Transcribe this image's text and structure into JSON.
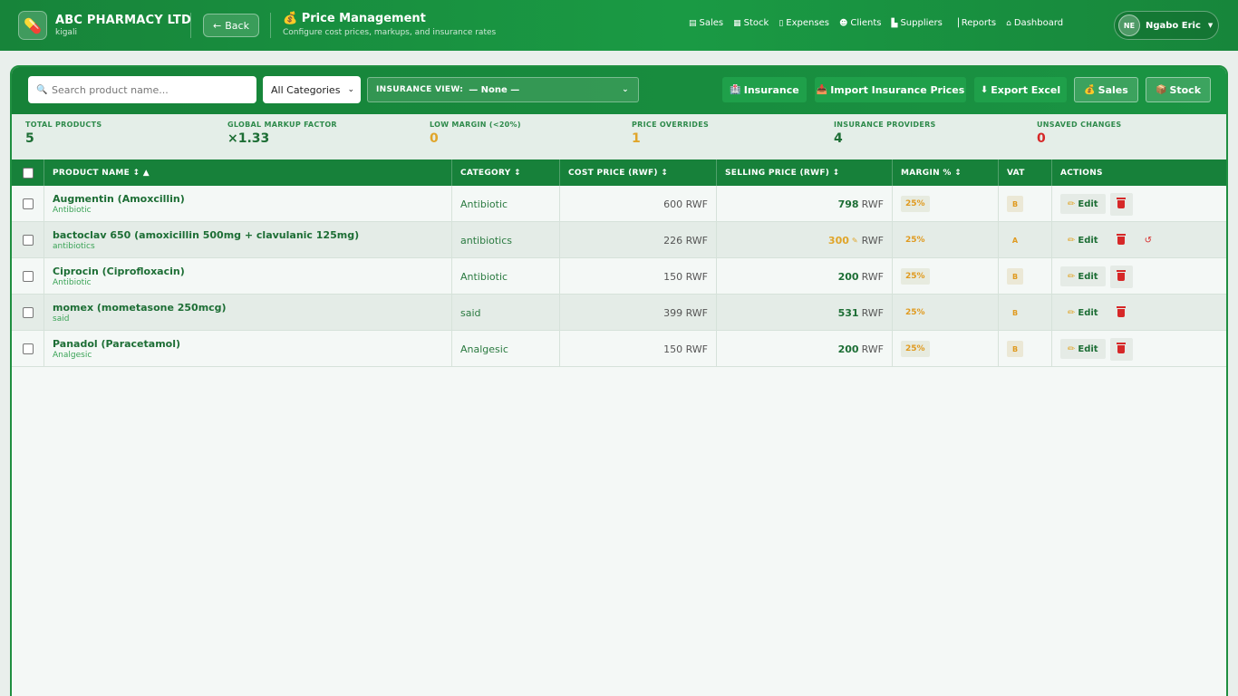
{
  "header": {
    "brand": "ABC PHARMACY LTD",
    "location": "kigali",
    "back_label": "Back",
    "title": "Price Management",
    "subtitle": "Configure cost prices, markups, and insurance rates",
    "nav": [
      {
        "label": "Sales",
        "icon": "receipt-icon"
      },
      {
        "label": "Stock",
        "icon": "boxes-icon"
      },
      {
        "label": "Expenses",
        "icon": "file-icon"
      },
      {
        "label": "Clients",
        "icon": "users-icon"
      },
      {
        "label": "Suppliers",
        "icon": "industry-icon"
      },
      {
        "label": "Reports",
        "icon": "chart-icon"
      },
      {
        "label": "Dashboard",
        "icon": "home-icon"
      }
    ],
    "user": {
      "initials": "NE",
      "name": "Ngabo Eric"
    }
  },
  "toolbar": {
    "search_placeholder": "Search product name...",
    "category_value": "All Categories",
    "insurance_view_label": "INSURANCE VIEW:",
    "insurance_view_value": "— None —",
    "buttons": {
      "insurance": "Insurance",
      "import": "Import Insurance Prices",
      "export": "Export Excel",
      "sales": "Sales",
      "stock": "Stock"
    }
  },
  "stats": [
    {
      "label": "TOTAL PRODUCTS",
      "value": "5",
      "color": "#1d6e35"
    },
    {
      "label": "GLOBAL MARKUP FACTOR",
      "value": "×1.33",
      "color": "#1d6e35"
    },
    {
      "label": "LOW MARGIN (<20%)",
      "value": "0",
      "color": "#e0a52a"
    },
    {
      "label": "PRICE OVERRIDES",
      "value": "1",
      "color": "#e0a52a"
    },
    {
      "label": "INSURANCE PROVIDERS",
      "value": "4",
      "color": "#1d6e35"
    },
    {
      "label": "UNSAVED CHANGES",
      "value": "0",
      "color": "#d62828"
    }
  ],
  "table": {
    "headers": {
      "product": "PRODUCT NAME ↕ ▲",
      "category": "CATEGORY ↕",
      "cost": "COST PRICE (RWF) ↕",
      "selling": "SELLING PRICE (RWF) ↕",
      "margin": "MARGIN % ↕",
      "vat": "VAT",
      "actions": "ACTIONS"
    },
    "edit_label": "Edit",
    "currency": "RWF",
    "rows": [
      {
        "name": "Augmentin (Amoxcillin)",
        "sub": "Antibiotic",
        "category": "Antibiotic",
        "cost": "600 RWF",
        "selling": "798",
        "margin": "25%",
        "vat": "B"
      },
      {
        "name": "bactoclav 650 (amoxicillin 500mg + clavulanic 125mg)",
        "sub": "antibiotics",
        "category": "antibiotics",
        "cost": "226 RWF",
        "selling": "300",
        "margin": "25%",
        "vat": "A"
      },
      {
        "name": "Ciprocin (Ciprofloxacin)",
        "sub": "Antibiotic",
        "category": "Antibiotic",
        "cost": "150 RWF",
        "selling": "200",
        "margin": "25%",
        "vat": "B"
      },
      {
        "name": "momex (mometasone 250mcg)",
        "sub": "said",
        "category": "said",
        "cost": "399 RWF",
        "selling": "531",
        "margin": "25%",
        "vat": "B"
      },
      {
        "name": "Panadol (Paracetamol)",
        "sub": "Analgesic",
        "category": "Analgesic",
        "cost": "150 RWF",
        "selling": "200",
        "margin": "25%",
        "vat": "B"
      }
    ]
  }
}
